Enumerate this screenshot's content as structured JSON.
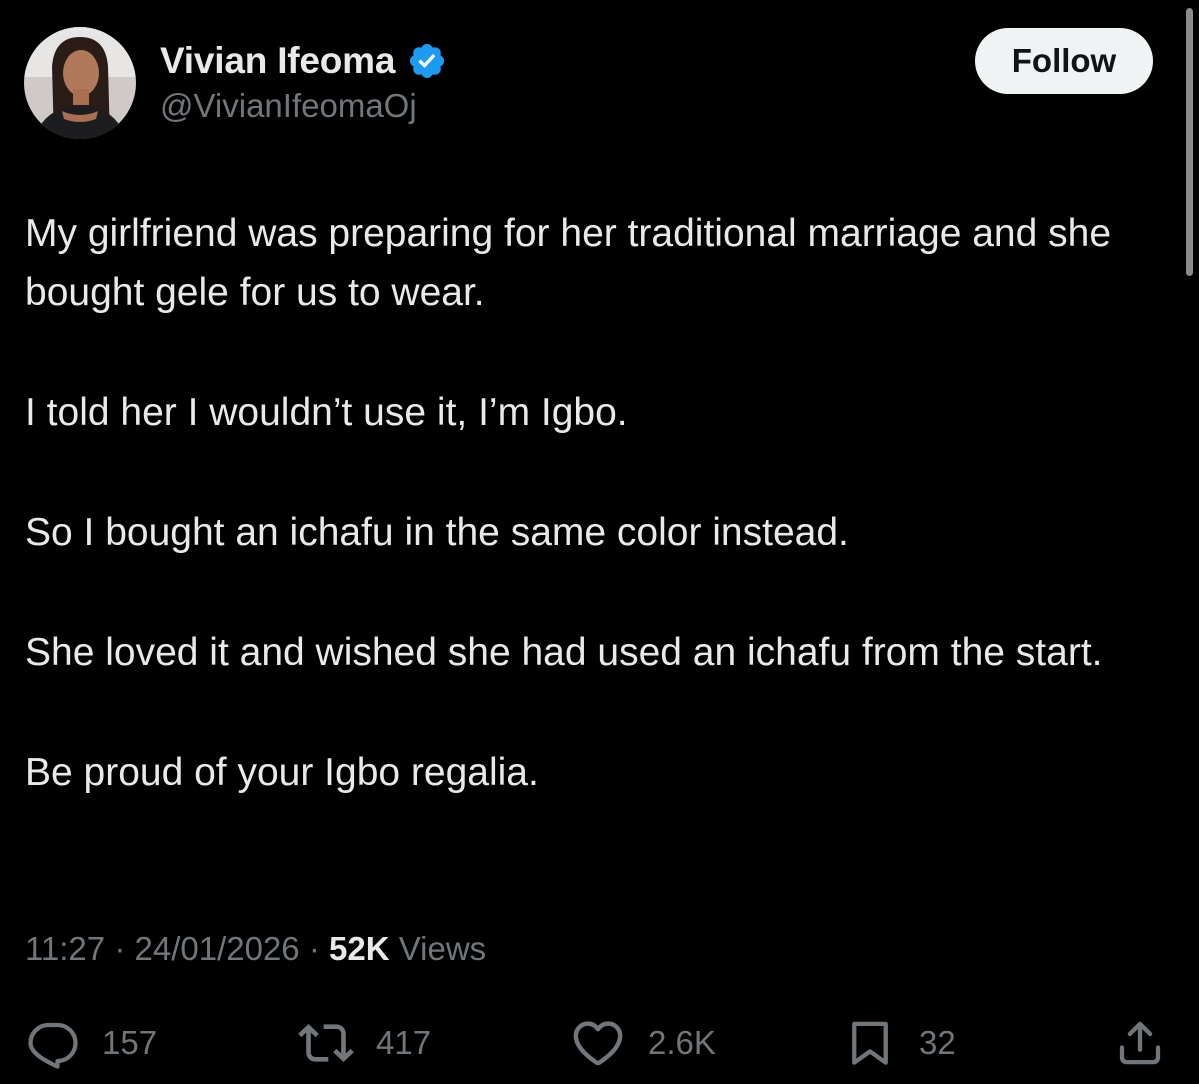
{
  "author": {
    "display_name": "Vivian Ifeoma",
    "handle": "@VivianIfeomaOj",
    "verified_icon": "verified-badge-icon",
    "verified_color": "#1d9bf0"
  },
  "follow_label": "Follow",
  "tweet_paragraphs": [
    "My girlfriend was preparing for her traditional marriage and she bought gele for us to wear.",
    "I told her I wouldn’t use it, I’m Igbo.",
    "So I bought an ichafu in the same color instead.",
    "She loved it and wished she had used an ichafu from the start.",
    "Be proud of your Igbo regalia."
  ],
  "meta": {
    "time": "11:27",
    "separator": "·",
    "date": "24/01/2026",
    "views_count": "52K",
    "views_label": "Views"
  },
  "actions": {
    "replies": "157",
    "reposts": "417",
    "likes": "2.6K",
    "bookmarks": "32"
  },
  "colors": {
    "background": "#000000",
    "primary_text": "#e7e9ea",
    "secondary_text": "#71767b",
    "follow_bg": "#eff3f4"
  }
}
